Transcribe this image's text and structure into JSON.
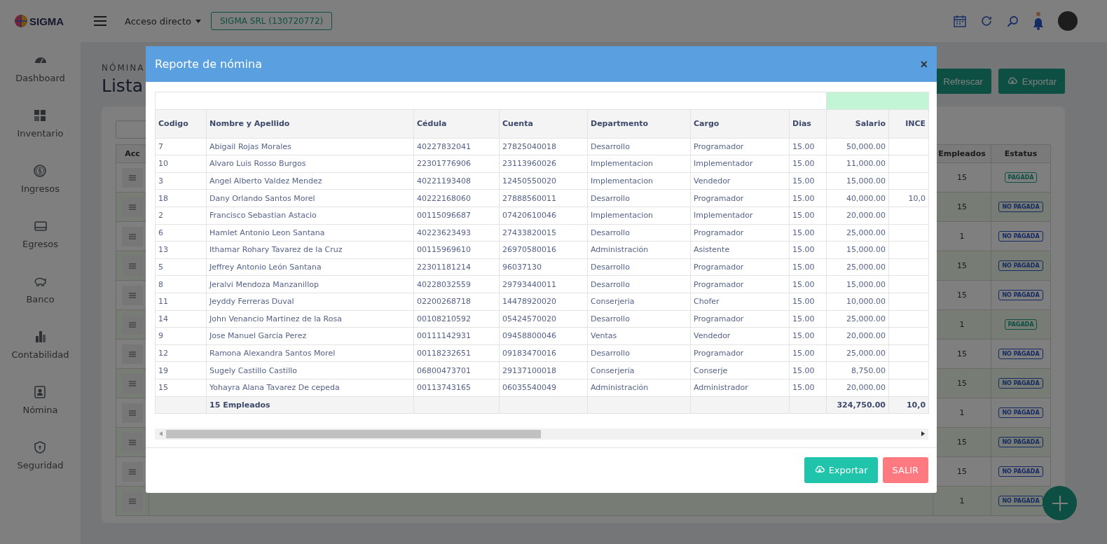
{
  "topbar": {
    "brand": "SIGMA",
    "shortcut_menu": "Acceso directo",
    "company_button": "SIGMA SRL (130720772)",
    "notifications_unread": true
  },
  "sidebar": {
    "items": [
      {
        "label": "Dashboard"
      },
      {
        "label": "Inventario"
      },
      {
        "label": "Ingresos"
      },
      {
        "label": "Egresos"
      },
      {
        "label": "Banco"
      },
      {
        "label": "Contabilidad"
      },
      {
        "label": "Nómina"
      },
      {
        "label": "Seguridad"
      }
    ]
  },
  "page": {
    "breadcrumb": "NÓMINA",
    "title": "Lista",
    "buttons": [
      {
        "label": "Refrescar",
        "kind": "refresh"
      },
      {
        "label": "Exportar",
        "kind": "export"
      }
    ],
    "table": {
      "columns": [
        "Acc",
        "Empleados",
        "Estatus"
      ],
      "rows": [
        {
          "employees": "15",
          "status": "PAGADA",
          "paid": true
        },
        {
          "employees": "15",
          "status": "NO PAGADA",
          "paid": false
        },
        {
          "employees": "1",
          "status": "NO PAGADA",
          "paid": false
        },
        {
          "employees": "15",
          "status": "NO PAGADA",
          "paid": false
        },
        {
          "employees": "15",
          "status": "NO PAGADA",
          "paid": false
        },
        {
          "employees": "1",
          "status": "PAGADA",
          "paid": true
        },
        {
          "employees": "15",
          "status": "NO PAGADA",
          "paid": false
        },
        {
          "employees": "15",
          "status": "NO PAGADA",
          "paid": false
        },
        {
          "employees": "1",
          "status": "NO PAGADA",
          "paid": false
        },
        {
          "employees": "15",
          "status": "NO PAGADA",
          "paid": false
        },
        {
          "employees": "15",
          "status": "NO PAGADA",
          "paid": false
        },
        {
          "employees": "1",
          "status": "NO PAGADA",
          "paid": false
        }
      ]
    }
  },
  "modal": {
    "title": "Reporte de nómina",
    "close": "×",
    "table": {
      "columns": [
        "Codigo",
        "Nombre y Apellido",
        "Cédula",
        "Cuenta",
        "Departmento",
        "Cargo",
        "Dias",
        "Salario",
        "INCE"
      ],
      "rows": [
        {
          "code": "7",
          "name": "Abigail Rojas Morales",
          "cedula": "40227832041",
          "account": "27825040018",
          "department": "Desarrollo",
          "position": "Programador",
          "days": "15.00",
          "salary": "50,000.00"
        },
        {
          "code": "10",
          "name": "Alvaro Luis Rosso Burgos",
          "cedula": "22301776906",
          "account": "23113960026",
          "department": "Implementacion",
          "position": "Implementador",
          "days": "15.00",
          "salary": "11,000.00"
        },
        {
          "code": "3",
          "name": "Angel Alberto Valdez Mendez",
          "cedula": "40221193408",
          "account": "12450550020",
          "department": "Implementacion",
          "position": "Vendedor",
          "days": "15.00",
          "salary": "15,000.00"
        },
        {
          "code": "18",
          "name": "Dany Orlando Santos Morel",
          "cedula": "40222168060",
          "account": "27888560011",
          "department": "Desarrollo",
          "position": "Programador",
          "days": "15.00",
          "salary": "40,000.00",
          "incentive": "10,0"
        },
        {
          "code": "2",
          "name": "Francisco Sebastian Astacio",
          "cedula": "00115096687",
          "account": "07420610046",
          "department": "Implementacion",
          "position": "Implementador",
          "days": "15.00",
          "salary": "20,000.00"
        },
        {
          "code": "6",
          "name": "Hamlet Antonio Leon Santana",
          "cedula": "40223623493",
          "account": "27433820015",
          "department": "Desarrollo",
          "position": "Programador",
          "days": "15.00",
          "salary": "25,000.00"
        },
        {
          "code": "13",
          "name": "Ithamar Rohary Tavarez de la Cruz",
          "cedula": "00115969610",
          "account": "26970580016",
          "department": "Administración",
          "position": "Asistente",
          "days": "15.00",
          "salary": "15,000.00"
        },
        {
          "code": "5",
          "name": "Jeffrey Antonio León Santana",
          "cedula": "22301181214",
          "account": "96037130",
          "department": "Desarrollo",
          "position": "Programador",
          "days": "15.00",
          "salary": "25,000.00"
        },
        {
          "code": "8",
          "name": "Jeralvi Mendoza Manzanillop",
          "cedula": "40228032559",
          "account": "29793440011",
          "department": "Desarrollo",
          "position": "Programador",
          "days": "15.00",
          "salary": "15,000.00"
        },
        {
          "code": "11",
          "name": "Jeyddy Ferreras Duval",
          "cedula": "02200268718",
          "account": "14478920020",
          "department": "Conserjeria",
          "position": "Chofer",
          "days": "15.00",
          "salary": "10,000.00"
        },
        {
          "code": "14",
          "name": "John Venancio Martinez de la Rosa",
          "cedula": "00108210592",
          "account": "05424570020",
          "department": "Desarrollo",
          "position": "Programador",
          "days": "15.00",
          "salary": "25,000.00"
        },
        {
          "code": "9",
          "name": "Jose Manuel Garcia Perez",
          "cedula": "00111142931",
          "account": "09458800046",
          "department": "Ventas",
          "position": "Vendedor",
          "days": "15.00",
          "salary": "20,000.00"
        },
        {
          "code": "12",
          "name": "Ramona Alexandra Santos Morel",
          "cedula": "00118232651",
          "account": "09183470016",
          "department": "Desarrollo",
          "position": "Programador",
          "days": "15.00",
          "salary": "25,000.00"
        },
        {
          "code": "19",
          "name": "Sugely Castillo Castillo",
          "cedula": "06800473701",
          "account": "29137100018",
          "department": "Conserjeria",
          "position": "Conserje",
          "days": "15.00",
          "salary": "8,750.00"
        },
        {
          "code": "15",
          "name": "Yohayra Alana Tavarez De cepeda",
          "cedula": "00113743165",
          "account": "06035540049",
          "department": "Administración",
          "position": "Administrador",
          "days": "15.00",
          "salary": "20,000.00"
        }
      ],
      "footer": {
        "label": "15 Empleados",
        "salary_total": "324,750.00",
        "incentive_total": "10,0"
      }
    },
    "buttons": [
      {
        "label": "Exportar",
        "kind": "export"
      },
      {
        "label": "SALIR",
        "kind": "exit"
      }
    ]
  }
}
